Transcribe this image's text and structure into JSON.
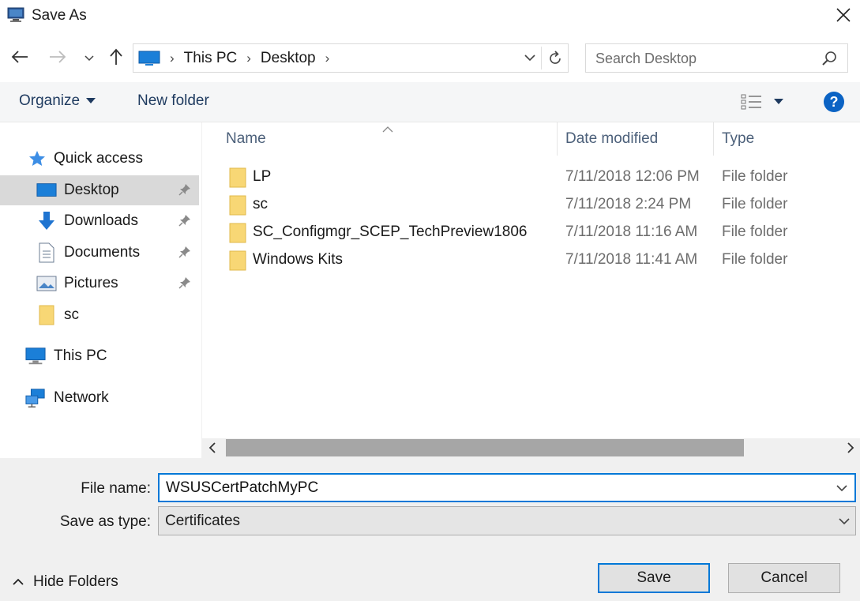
{
  "window": {
    "title": "Save As"
  },
  "address": {
    "crumbs": [
      "This PC",
      "Desktop"
    ]
  },
  "search": {
    "placeholder": "Search Desktop"
  },
  "commandbar": {
    "organize": "Organize",
    "new_folder": "New folder"
  },
  "navpane": {
    "items": [
      {
        "label": "Quick access"
      },
      {
        "label": "Desktop"
      },
      {
        "label": "Downloads"
      },
      {
        "label": "Documents"
      },
      {
        "label": "Pictures"
      },
      {
        "label": "sc"
      },
      {
        "label": "This PC"
      },
      {
        "label": "Network"
      }
    ],
    "selected": "Desktop"
  },
  "filelist": {
    "columns": {
      "name": "Name",
      "date": "Date modified",
      "type": "Type"
    },
    "rows": [
      {
        "name": "LP",
        "date": "7/11/2018 12:06 PM",
        "type": "File folder"
      },
      {
        "name": "sc",
        "date": "7/11/2018 2:24 PM",
        "type": "File folder"
      },
      {
        "name": "SC_Configmgr_SCEP_TechPreview1806",
        "date": "7/11/2018 11:16 AM",
        "type": "File folder"
      },
      {
        "name": "Windows Kits",
        "date": "7/11/2018 11:41 AM",
        "type": "File folder"
      }
    ]
  },
  "form": {
    "file_name_label": "File name:",
    "file_name_value": "WSUSCertPatchMyPC",
    "save_as_type_label": "Save as type:",
    "save_as_type_value": "Certificates"
  },
  "buttons": {
    "save": "Save",
    "cancel": "Cancel",
    "hide_folders": "Hide Folders"
  },
  "colors": {
    "accent": "#0078d7",
    "folder": "#f8d775",
    "help": "#0b63c4"
  }
}
